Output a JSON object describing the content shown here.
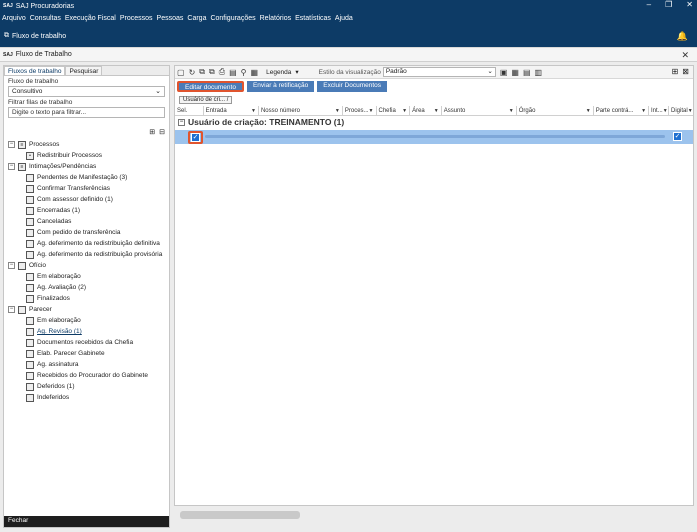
{
  "app": {
    "logo": "SAJ",
    "title": "SAJ Procuradorias"
  },
  "window_controls": [
    "–",
    "❐",
    "✕"
  ],
  "menu": [
    "Arquivo",
    "Consultas",
    "Execução Fiscal",
    "Processos",
    "Pessoas",
    "Carga",
    "Configurações",
    "Relatórios",
    "Estatísticas",
    "Ajuda"
  ],
  "ribbon": {
    "fluxo_label": "Fluxo de trabalho"
  },
  "subwindow": {
    "title": "Fluxo de Trabalho"
  },
  "left": {
    "tabs": [
      "Fluxos de trabalho",
      "Pesquisar"
    ],
    "fluxo_label": "Fluxo de trabalho",
    "fluxo_value": "Consultivo",
    "filtrar_label": "Filtrar filas de trabalho",
    "filtrar_placeholder": "Digite o texto para filtrar...",
    "tree": [
      {
        "label": "Processos",
        "level": 0,
        "toggle": "−"
      },
      {
        "label": "Redistribuir Processos",
        "level": 1
      },
      {
        "label": "Intimações/Pendências",
        "level": 0,
        "toggle": "−"
      },
      {
        "label": "Pendentes de Manifestação (3)",
        "level": 1
      },
      {
        "label": "Confirmar Transferências",
        "level": 1
      },
      {
        "label": "Com assessor definido (1)",
        "level": 1
      },
      {
        "label": "Encerradas (1)",
        "level": 1
      },
      {
        "label": "Canceladas",
        "level": 1
      },
      {
        "label": "Com pedido de transferência",
        "level": 1
      },
      {
        "label": "Ag. deferimento da redistribuição definitiva",
        "level": 1
      },
      {
        "label": "Ag. deferimento da redistribuição provisória",
        "level": 1
      },
      {
        "label": "Ofício",
        "level": 0,
        "toggle": "−"
      },
      {
        "label": "Em elaboração",
        "level": 1
      },
      {
        "label": "Ag. Avaliação (2)",
        "level": 1
      },
      {
        "label": "Finalizados",
        "level": 1
      },
      {
        "label": "Parecer",
        "level": 0,
        "toggle": "−"
      },
      {
        "label": "Em elaboração",
        "level": 1
      },
      {
        "label": "Ag. Revisão (1)",
        "level": 1,
        "selected": true
      },
      {
        "label": "Documentos recebidos da Chefia",
        "level": 1
      },
      {
        "label": "Elab. Parecer Gabinete",
        "level": 1
      },
      {
        "label": "Ag. assinatura",
        "level": 1
      },
      {
        "label": "Recebidos do Procurador do Gabinete",
        "level": 1
      },
      {
        "label": "Deferidos (1)",
        "level": 1
      },
      {
        "label": "Indeferidos",
        "level": 1
      }
    ],
    "fechar": "Fechar"
  },
  "toolbar": {
    "legenda": "Legenda",
    "estilo_label": "Estilo da visualização",
    "estilo_value": "Padrão"
  },
  "actions": {
    "editar": "Editar documento",
    "retificacao": "Enviar à retificação",
    "excluir": "Excluir Documentos"
  },
  "group_chip": "Usuário de cri...",
  "columns": [
    "Sel.",
    "Entrada",
    "Nosso número",
    "Proces...",
    "Chefia",
    "Área",
    "Assunto",
    "Órgão",
    "Parte contrá...",
    "Int...",
    "Digital"
  ],
  "group_row": "Usuário de criação: TREINAMENTO  (1)",
  "accent": "#e0542e",
  "header_bg": "#0d3b66"
}
